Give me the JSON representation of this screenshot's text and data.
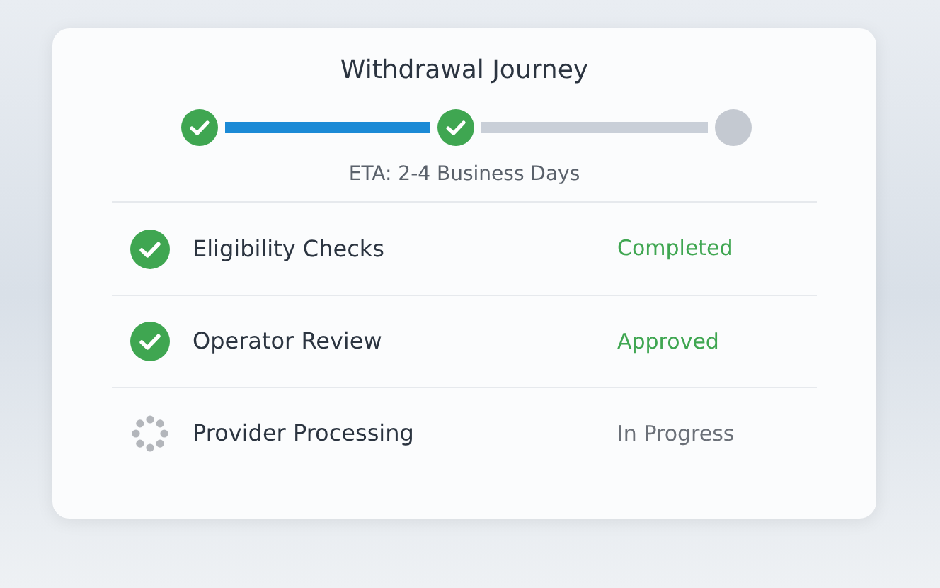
{
  "title": "Withdrawal Journey",
  "stepper": {
    "steps": [
      {
        "done": true
      },
      {
        "done": true
      },
      {
        "done": false
      }
    ],
    "connectors": [
      {
        "done": true
      },
      {
        "done": false
      }
    ]
  },
  "eta": "ETA: 2-4 Business Days",
  "stages": [
    {
      "kind": "done",
      "label": "Eligibility Checks",
      "status": "Completed"
    },
    {
      "kind": "done",
      "label": "Operator Review",
      "status": "Approved"
    },
    {
      "kind": "loading",
      "label": "Provider Processing",
      "status": "In Progress"
    }
  ]
}
